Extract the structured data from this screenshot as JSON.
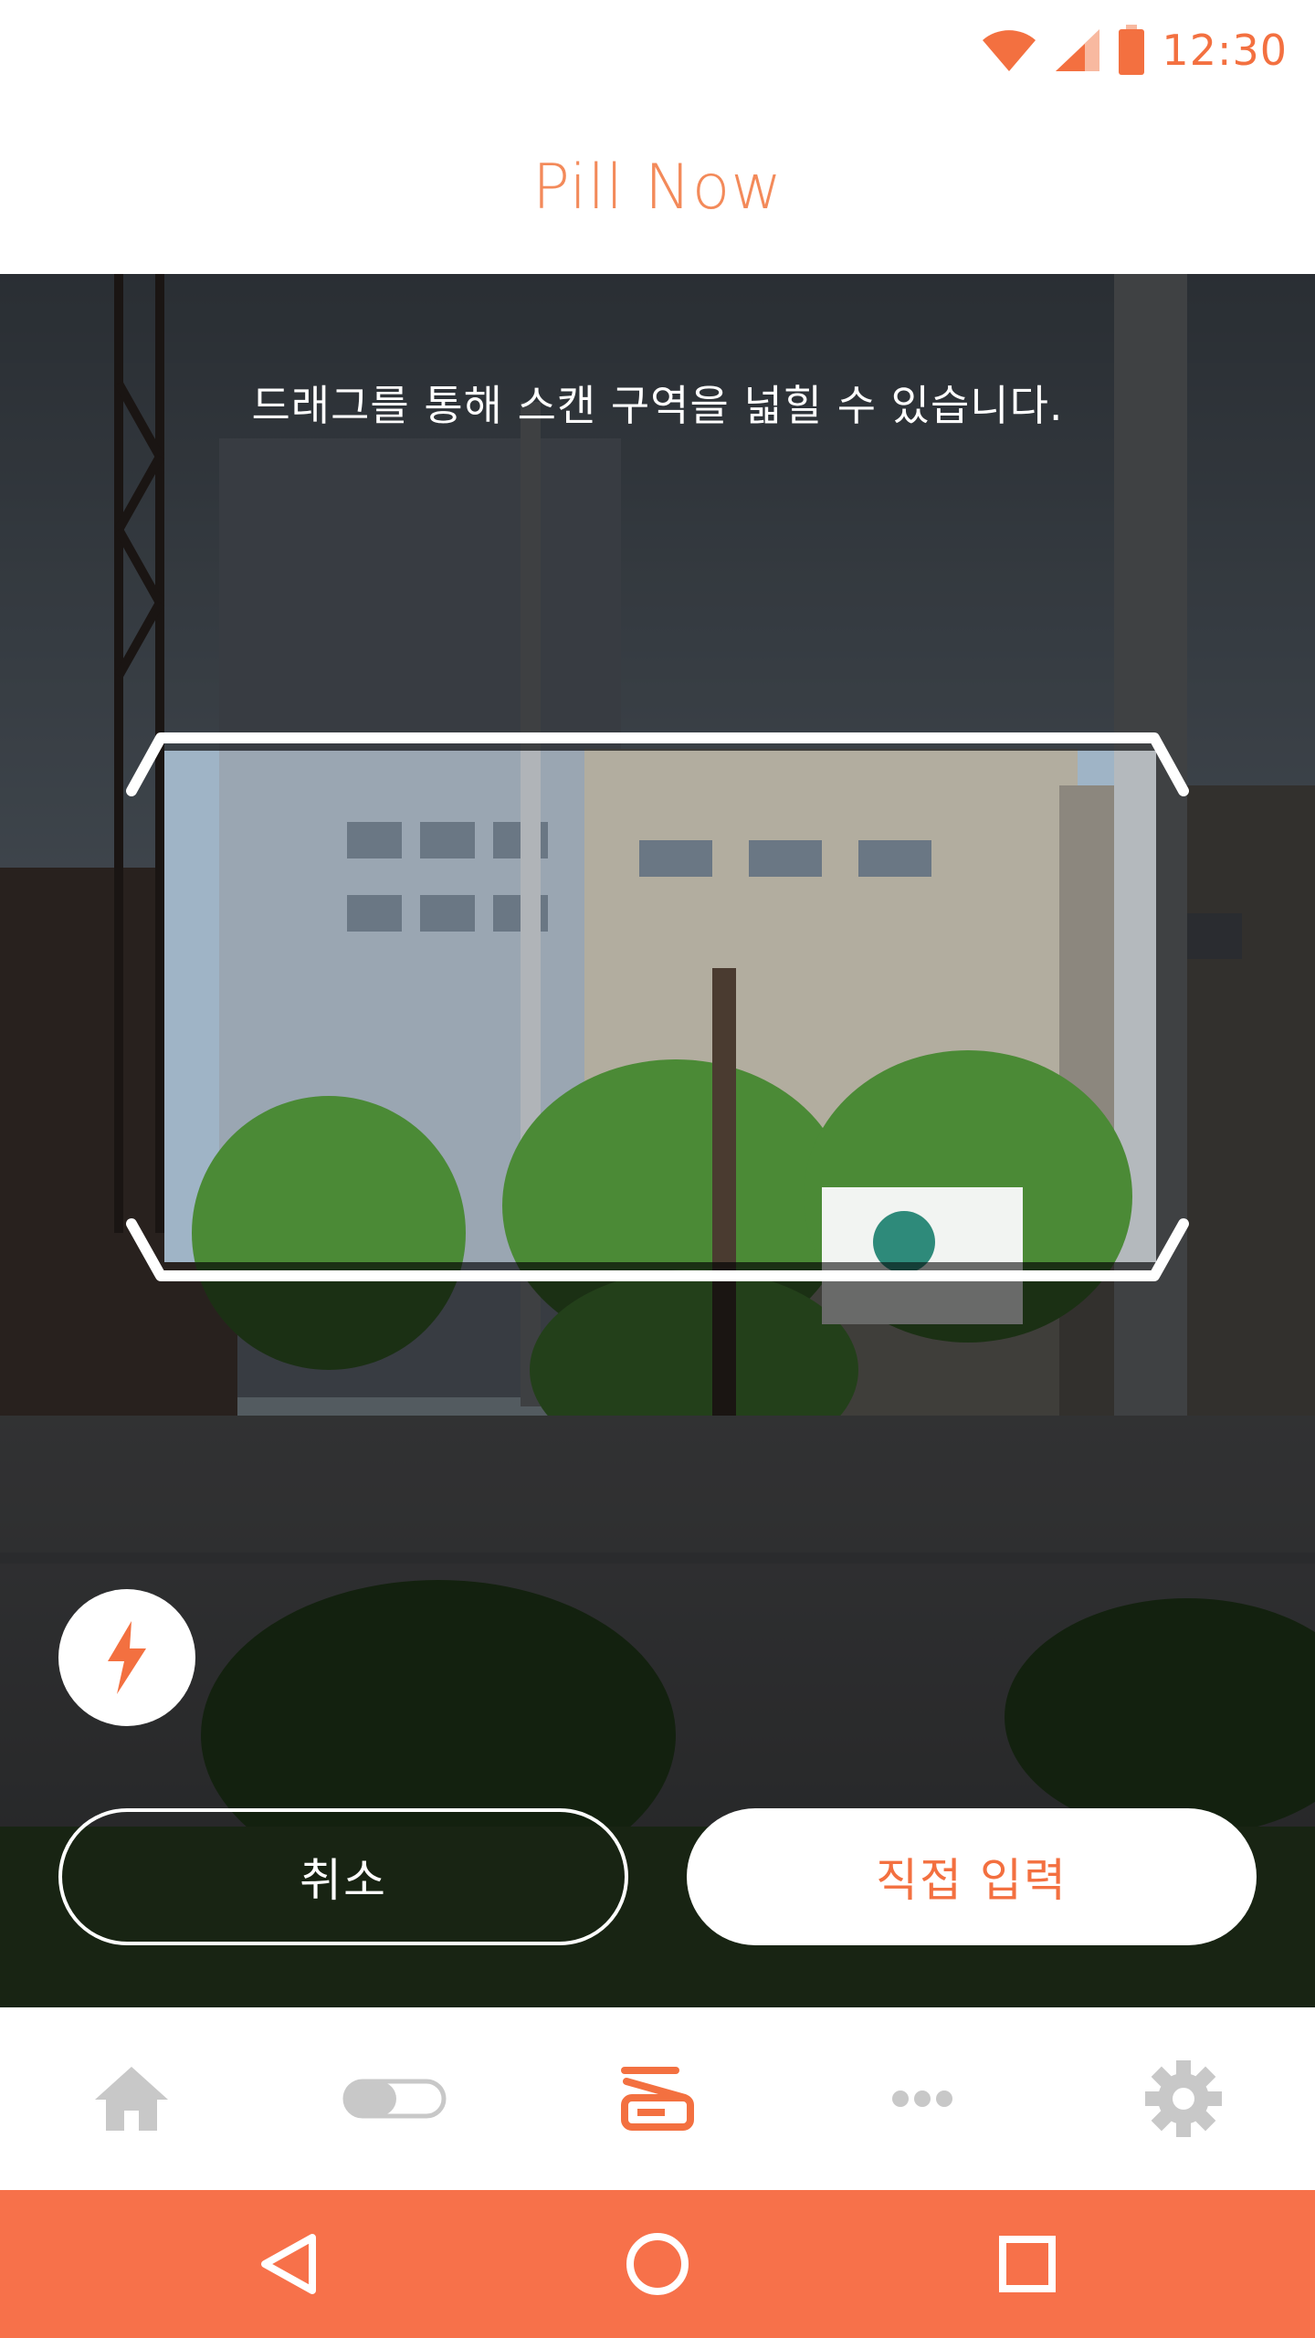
{
  "status_bar": {
    "time": "12:30",
    "accent_color": "#f37040"
  },
  "app": {
    "title": "Pill Now",
    "title_color": "#f38a5a"
  },
  "scanner": {
    "hint": "드래그를 통해 스캔 구역을 넓힐 수 있습니다.",
    "flash_icon": "flash-icon",
    "cancel_label": "취소",
    "manual_label": "직접 입력"
  },
  "tab_bar": {
    "items": [
      {
        "id": "home",
        "icon": "home-icon",
        "active": false
      },
      {
        "id": "toggle",
        "icon": "toggle-icon",
        "active": false
      },
      {
        "id": "scan",
        "icon": "scanner-icon",
        "active": true
      },
      {
        "id": "more",
        "icon": "more-icon",
        "active": false
      },
      {
        "id": "settings",
        "icon": "gear-icon",
        "active": false
      }
    ],
    "active_color": "#f37040",
    "inactive_color": "#c8c8c8"
  },
  "nav_bar": {
    "color": "#f7714a",
    "items": [
      "back-icon",
      "home-circle-icon",
      "recents-icon"
    ]
  }
}
